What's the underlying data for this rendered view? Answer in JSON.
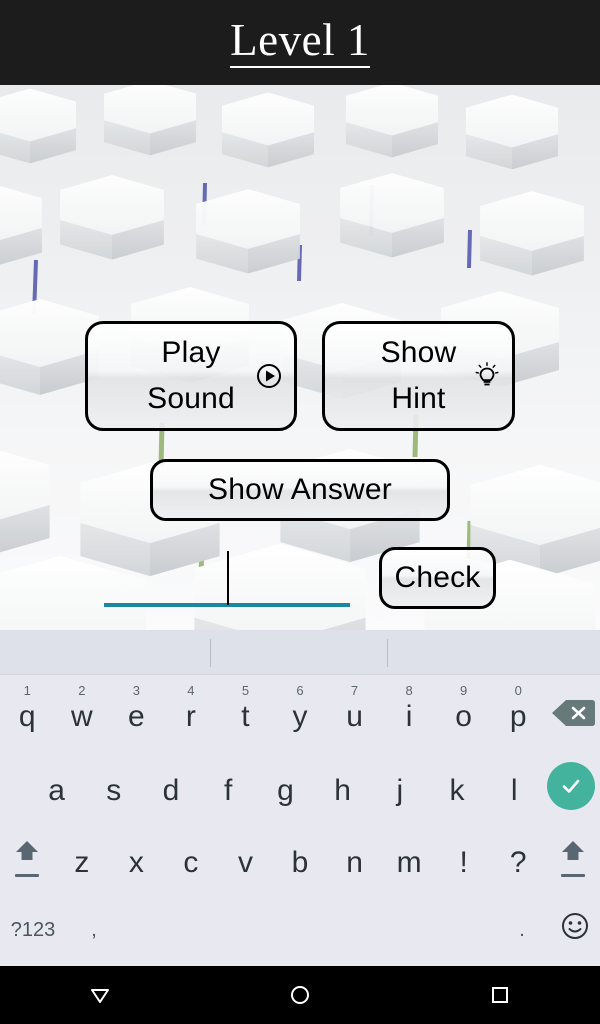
{
  "header": {
    "title": "Level 1"
  },
  "game": {
    "background_name": "hexagon-tiles",
    "accent_top_color": "#3b3fa0",
    "accent_bottom_color": "#7aa24a",
    "buttons": [
      {
        "id": "play-sound",
        "label": "Play\nSound",
        "line1": "Play",
        "line2": "Sound",
        "icon": "play-icon"
      },
      {
        "id": "show-hint",
        "label": "Show\nHint",
        "line1": "Show",
        "line2": "Hint",
        "icon": "lightbulb-icon"
      },
      {
        "id": "show-answer",
        "label": "Show Answer",
        "icon": null
      },
      {
        "id": "check",
        "label": "Check",
        "icon": null
      }
    ],
    "answer_field": {
      "value": "",
      "placeholder": "",
      "underline_color": "#1a88a0",
      "caret_visible": true
    }
  },
  "keyboard": {
    "suggestions": [
      "",
      "",
      ""
    ],
    "row1": [
      {
        "key": "q",
        "hint": "1"
      },
      {
        "key": "w",
        "hint": "2"
      },
      {
        "key": "e",
        "hint": "3"
      },
      {
        "key": "r",
        "hint": "4"
      },
      {
        "key": "t",
        "hint": "5"
      },
      {
        "key": "y",
        "hint": "6"
      },
      {
        "key": "u",
        "hint": "7"
      },
      {
        "key": "i",
        "hint": "8"
      },
      {
        "key": "o",
        "hint": "9"
      },
      {
        "key": "p",
        "hint": "0"
      }
    ],
    "backspace_label": "backspace-key",
    "row2": [
      "a",
      "s",
      "d",
      "f",
      "g",
      "h",
      "j",
      "k",
      "l"
    ],
    "enter_label": "enter-key",
    "row3": [
      "z",
      "x",
      "c",
      "v",
      "b",
      "n",
      "m",
      "!",
      "?"
    ],
    "shift_label": "shift-key",
    "row4": {
      "symbols_label": "?123",
      "comma_label": ",",
      "space_label": "",
      "period_label": ".",
      "emoji_label": "emoji-key"
    },
    "enter_color": "#43b39d",
    "backspace_color": "#667a7a",
    "space_color": "#c8cad3",
    "background_color": "#e8e9f0",
    "suggestion_bar_color": "#dfe1ea"
  },
  "navbar": {
    "back_label": "back-button",
    "home_label": "home-button",
    "recents_label": "recents-button"
  }
}
